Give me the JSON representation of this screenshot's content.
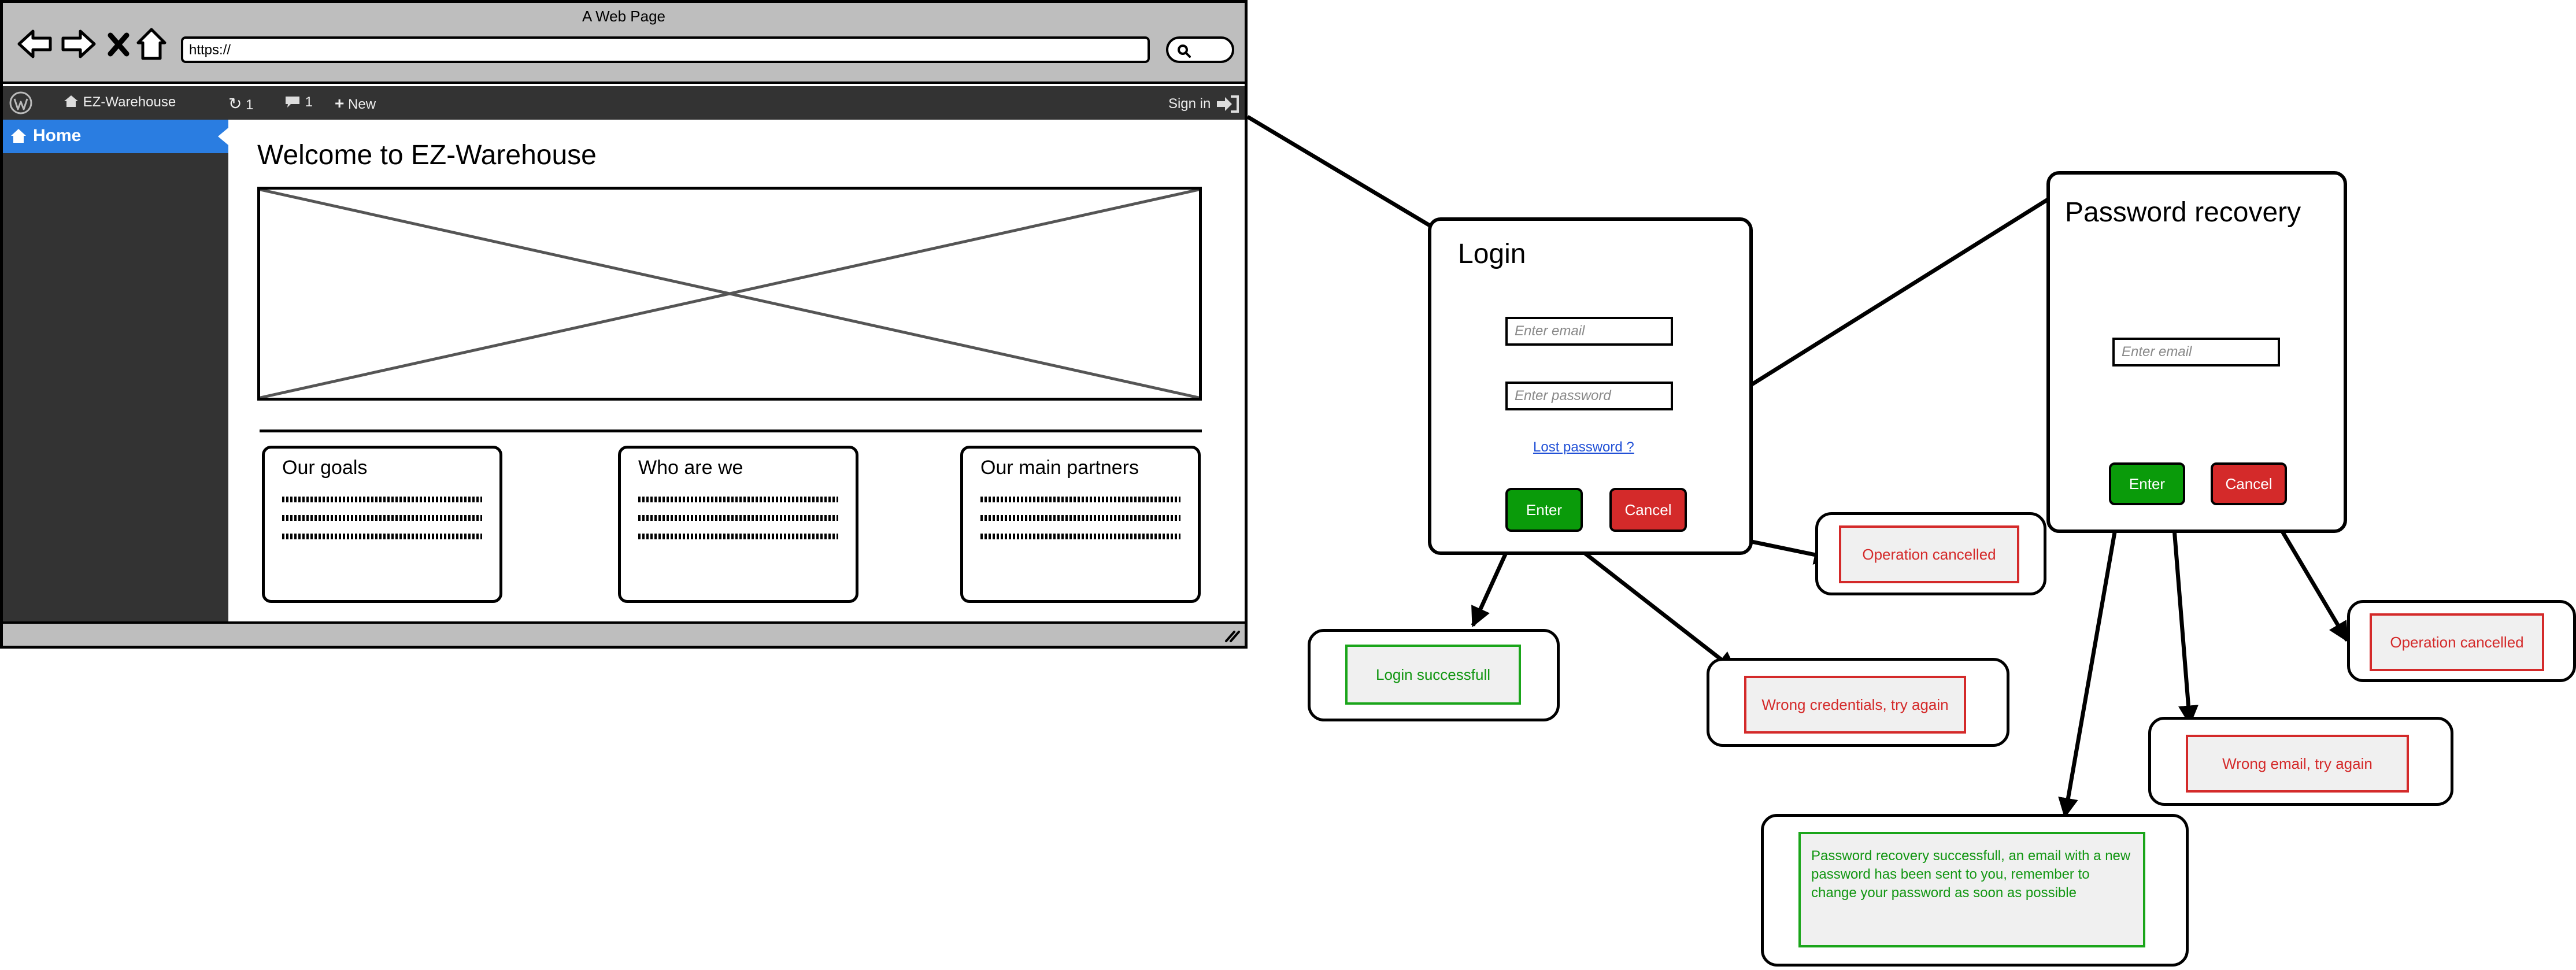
{
  "browser": {
    "title": "A Web Page",
    "url": "https://",
    "nav_icons": [
      "back-arrow-icon",
      "forward-arrow-icon",
      "close-icon",
      "home-icon"
    ]
  },
  "admin_bar": {
    "site_name": "EZ-Warehouse",
    "updates_count": "1",
    "comments_count": "1",
    "new_label": "New",
    "sign_in_label": "Sign in"
  },
  "sidebar": {
    "items": [
      {
        "label": "Home",
        "icon": "home-icon",
        "active": true
      }
    ]
  },
  "main": {
    "heading": "Welcome to EZ-Warehouse",
    "cards": [
      {
        "title": "Our goals"
      },
      {
        "title": "Who are we"
      },
      {
        "title": "Our main partners"
      }
    ]
  },
  "login": {
    "title": "Login",
    "email_placeholder": "Enter email",
    "password_placeholder": "Enter password",
    "lost_password_label": "Lost password ?",
    "enter_label": "Enter",
    "cancel_label": "Cancel"
  },
  "recovery": {
    "title": "Password recovery",
    "email_placeholder": "Enter email",
    "enter_label": "Enter",
    "cancel_label": "Cancel"
  },
  "messages": {
    "login_cancelled": "Operation cancelled",
    "login_success": "Login successfull",
    "wrong_credentials": "Wrong credentials, try again",
    "recovery_cancelled": "Operation cancelled",
    "wrong_email": "Wrong email, try again",
    "recovery_success": "Password recovery successfull, an email with a new password has been sent to you, remember to change your password as soon as possible"
  },
  "colors": {
    "enter_button": "#0a9b0a",
    "cancel_button": "#d42a2a",
    "error_text": "#d42a2a",
    "success_text": "#129612",
    "sidebar_active": "#2a7de1",
    "admin_bar": "#333333",
    "browser_chrome": "#bebebe"
  }
}
